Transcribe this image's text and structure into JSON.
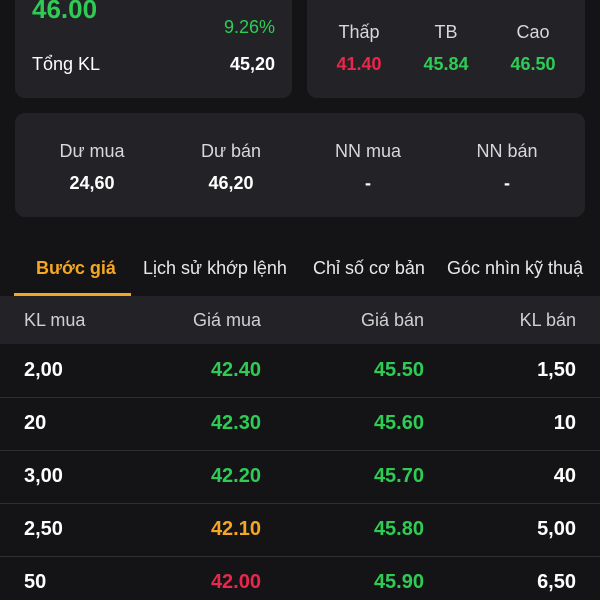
{
  "colors": {
    "up": "#2ecc55",
    "down": "#e8274b",
    "reference": "#f5a623",
    "text": "#ffffff",
    "label": "#d8d8d8",
    "card": "#232327",
    "background": "#141416"
  },
  "summary": {
    "last_price": "46.00",
    "change_percent": "9.26%",
    "total_volume_label": "Tổng KL",
    "total_volume_value": "45,20"
  },
  "range": {
    "low_label": "Thấp",
    "low_value": "41.40",
    "avg_label": "TB",
    "avg_value": "45.84",
    "high_label": "Cao",
    "high_value": "46.50"
  },
  "flow": {
    "buy_surplus_label": "Dư mua",
    "buy_surplus_value": "24,60",
    "sell_surplus_label": "Dư bán",
    "sell_surplus_value": "46,20",
    "foreign_buy_label": "NN mua",
    "foreign_buy_value": "-",
    "foreign_sell_label": "NN bán",
    "foreign_sell_value": "-"
  },
  "tabs": [
    {
      "label": "Bước giá",
      "active": true
    },
    {
      "label": "Lịch sử khớp lệnh",
      "active": false
    },
    {
      "label": "Chỉ số cơ bản",
      "active": false
    },
    {
      "label": "Góc nhìn kỹ thuậ",
      "active": false
    }
  ],
  "order_book": {
    "headers": {
      "bid_volume": "KL mua",
      "bid_price": "Giá mua",
      "ask_price": "Giá bán",
      "ask_volume": "KL bán"
    },
    "rows": [
      {
        "bid_volume": "2,00",
        "bid_price": "42.40",
        "bid_color": "up",
        "ask_price": "45.50",
        "ask_color": "up",
        "ask_volume": "1,50"
      },
      {
        "bid_volume": "20",
        "bid_price": "42.30",
        "bid_color": "up",
        "ask_price": "45.60",
        "ask_color": "up",
        "ask_volume": "10"
      },
      {
        "bid_volume": "3,00",
        "bid_price": "42.20",
        "bid_color": "up",
        "ask_price": "45.70",
        "ask_color": "up",
        "ask_volume": "40"
      },
      {
        "bid_volume": "2,50",
        "bid_price": "42.10",
        "bid_color": "reference",
        "ask_price": "45.80",
        "ask_color": "up",
        "ask_volume": "5,00"
      },
      {
        "bid_volume": "50",
        "bid_price": "42.00",
        "bid_color": "down",
        "ask_price": "45.90",
        "ask_color": "up",
        "ask_volume": "6,50"
      }
    ]
  }
}
